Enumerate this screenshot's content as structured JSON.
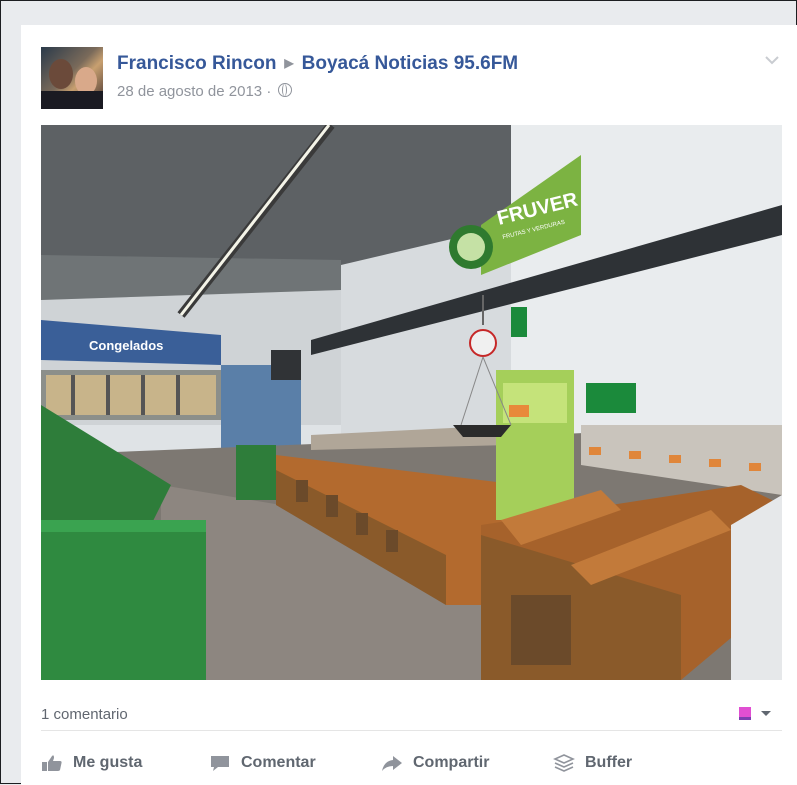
{
  "post": {
    "author": "Francisco Rincon",
    "target": "Boyacá Noticias 95.6FM",
    "date": "28 de agosto de 2013",
    "date_separator": "·",
    "photo": {
      "sign_text": "FRUVER",
      "sign_subtext": "FRUTAS Y VERDURAS",
      "banner_text": "Congelados"
    },
    "comment_count": "1 comentario"
  },
  "actions": {
    "like_label": "Me gusta",
    "comment_label": "Comentar",
    "share_label": "Compartir",
    "buffer_label": "Buffer"
  },
  "icons": {
    "options": "chevron-down-icon",
    "privacy": "globe-icon",
    "like": "thumbs-up-icon",
    "comment": "speech-bubble-icon",
    "share": "share-arrow-icon",
    "buffer": "buffer-stack-icon",
    "reaction": "page-avatar-icon"
  },
  "colors": {
    "link": "#365899",
    "meta": "#90949c",
    "action": "#606770",
    "sign_green": "#7cb342"
  }
}
